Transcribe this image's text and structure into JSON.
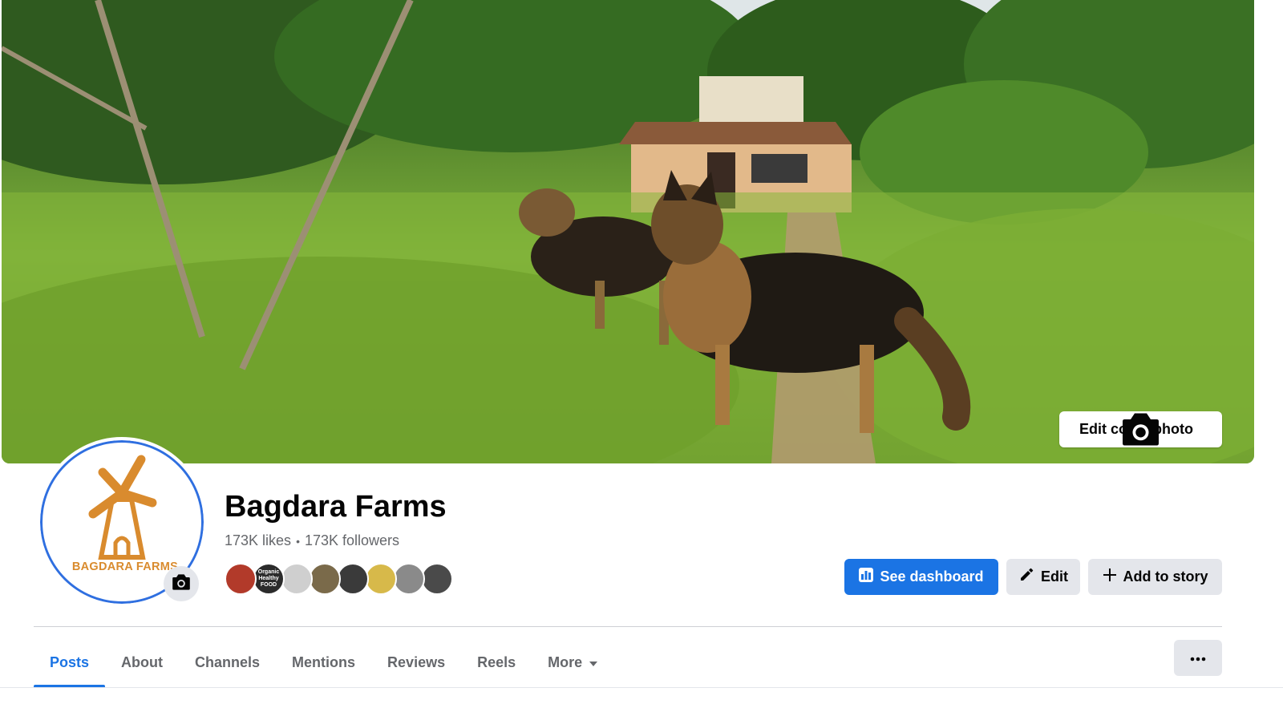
{
  "cover": {
    "edit_label": "Edit cover photo",
    "icon": "camera-icon"
  },
  "profile": {
    "logo_text": "BAGDARA FARMS",
    "logo_color": "#d98b2e",
    "ring_color": "#2f6fe0",
    "camera_icon": "camera-icon"
  },
  "page": {
    "title": "Bagdara Farms",
    "likes": "173K likes",
    "separator": "•",
    "followers": "173K followers",
    "friend_avatars": [
      {
        "color": "#b23a2a",
        "label": ""
      },
      {
        "color": "#2b2b2b",
        "label": "Organic Healthy FOOD"
      },
      {
        "color": "#cfcfcf",
        "label": ""
      },
      {
        "color": "#7a6a4a",
        "label": ""
      },
      {
        "color": "#3a3a3a",
        "label": ""
      },
      {
        "color": "#d7b94a",
        "label": ""
      },
      {
        "color": "#8a8a8a",
        "label": ""
      },
      {
        "color": "#4a4a4a",
        "label": ""
      }
    ]
  },
  "actions": {
    "dashboard_label": "See dashboard",
    "edit_label": "Edit",
    "story_label": "Add to story",
    "primary_color": "#1b74e4"
  },
  "tabs": [
    {
      "label": "Posts",
      "active": true
    },
    {
      "label": "About",
      "active": false
    },
    {
      "label": "Channels",
      "active": false
    },
    {
      "label": "Mentions",
      "active": false
    },
    {
      "label": "Reviews",
      "active": false
    },
    {
      "label": "Reels",
      "active": false
    },
    {
      "label": "More",
      "active": false,
      "dropdown": true
    }
  ],
  "more_options_icon": "ellipsis-icon"
}
